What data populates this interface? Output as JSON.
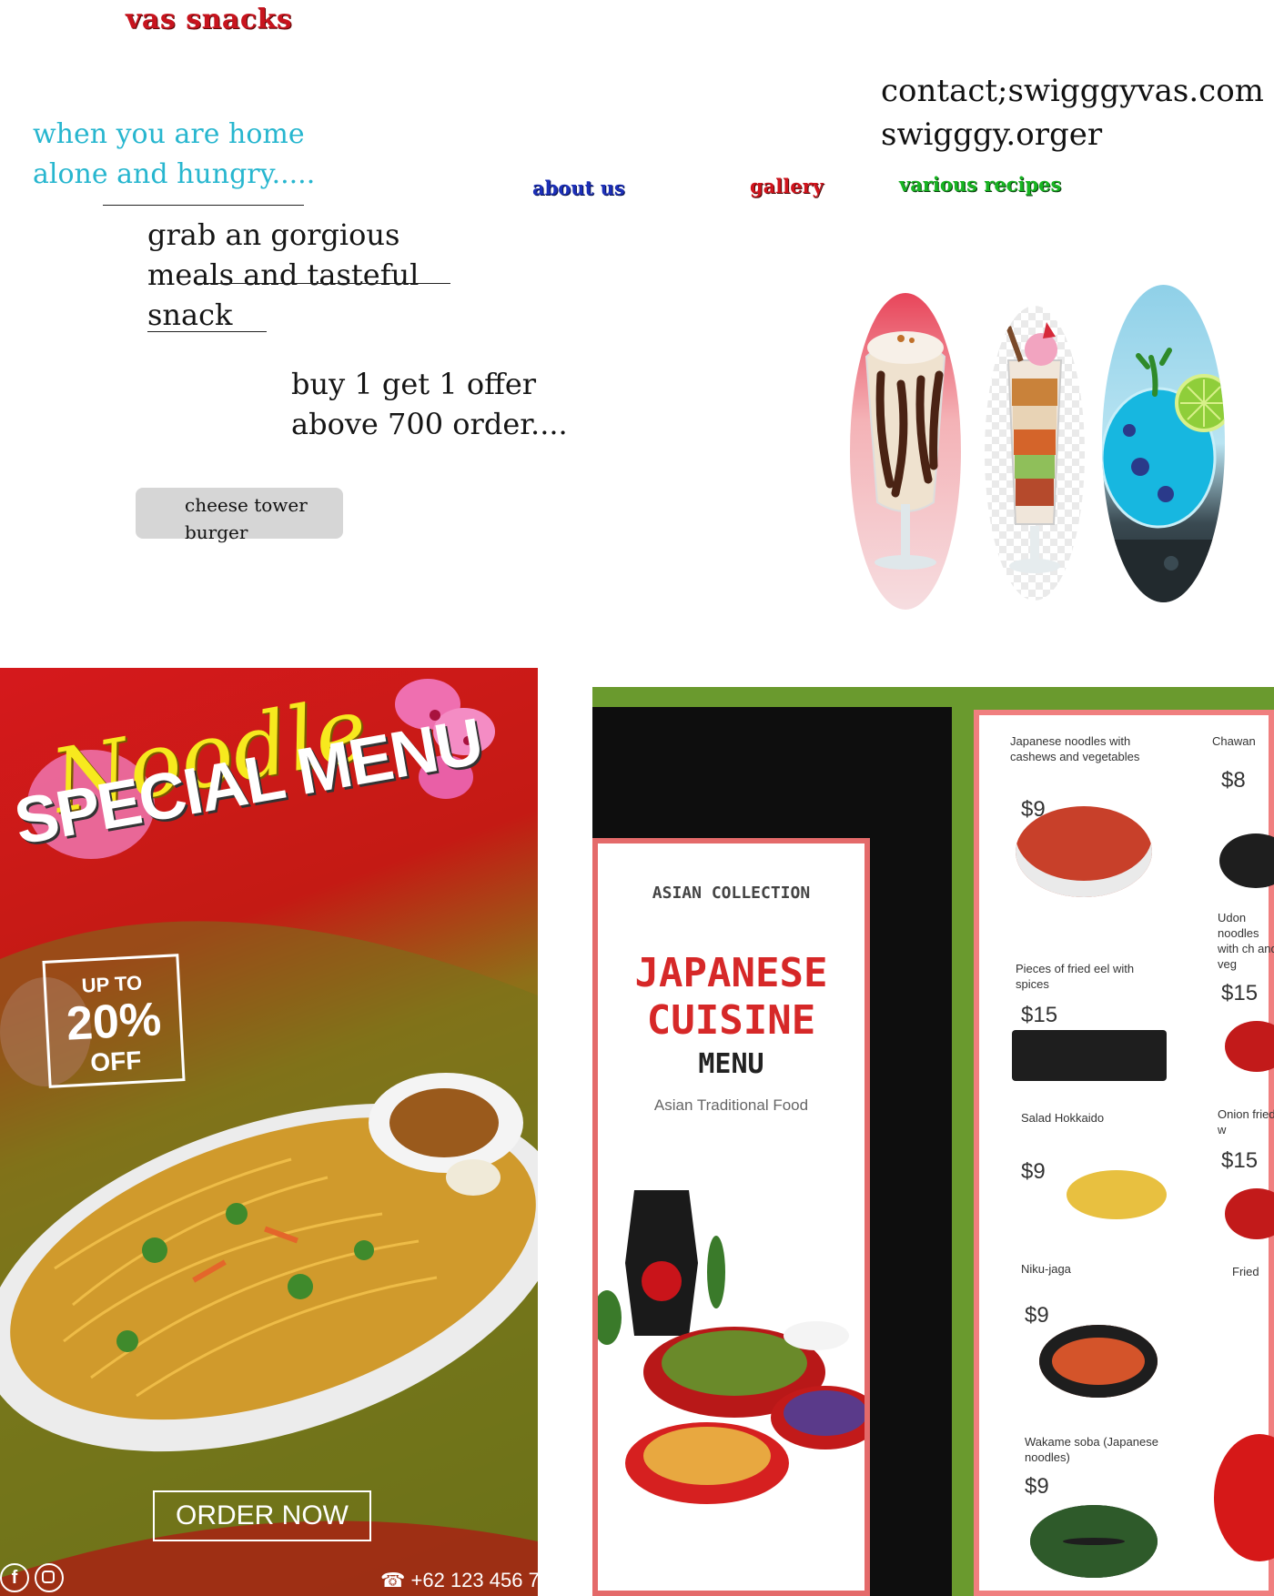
{
  "header": {
    "brand": "vas snacks",
    "tagline": "when you are home alone and hungry.....",
    "contact": "contact;swigggyvas.com swigggy.orger",
    "nav": {
      "about": "about us",
      "gallery": "gallery",
      "recipes": "various recipes"
    }
  },
  "hero": {
    "line1": "grab an gorgious",
    "line2": "meals and tasteful",
    "line3": "snack",
    "offer": "buy 1 get 1 offer above 700 order....",
    "cta": "cheese tower burger"
  },
  "drinks": [
    {
      "icon": "milkshake-image"
    },
    {
      "icon": "parfait-image"
    },
    {
      "icon": "blue-drink-image"
    }
  ],
  "noodle_poster": {
    "script_title": "Noodle",
    "title": "SPECIAL MENU",
    "discount_up": "UP TO",
    "discount_value": "20%",
    "discount_off": "OFF",
    "order_button": "ORDER NOW",
    "phone": "+62 123 456 7",
    "social": [
      "facebook-icon",
      "instagram-icon"
    ]
  },
  "japanese_poster": {
    "kicker": "ASIAN COLLECTION",
    "title_line1": "JAPANESE",
    "title_line2": "CUISINE",
    "title_line3": "MENU",
    "subtitle": "Asian Traditional Food",
    "items": [
      {
        "name": "Japanese noodles with cashews and vegetables",
        "price": "$9"
      },
      {
        "name": "Pieces of fried eel with spices",
        "price": "$15"
      },
      {
        "name": "Salad Hokkaido",
        "price": "$9"
      },
      {
        "name": "Niku-jaga",
        "price": "$9"
      },
      {
        "name": "Wakame soba (Japanese noodles)",
        "price": "$9"
      }
    ],
    "items_right": [
      {
        "name": "Chawan",
        "price": "$8"
      },
      {
        "name": "Udon noodles with ch and veg",
        "price": "$15"
      },
      {
        "name": "Onion fried w",
        "price": "$15"
      },
      {
        "name": "Fried",
        "price": ""
      }
    ]
  },
  "colors": {
    "brand_red": "#c8141e",
    "tagline_cyan": "#27b6cf",
    "about_blue": "#1c2fb8",
    "gallery_red": "#d0141d",
    "recipes_green": "#18b422",
    "cta_gray": "#d6d6d6"
  }
}
